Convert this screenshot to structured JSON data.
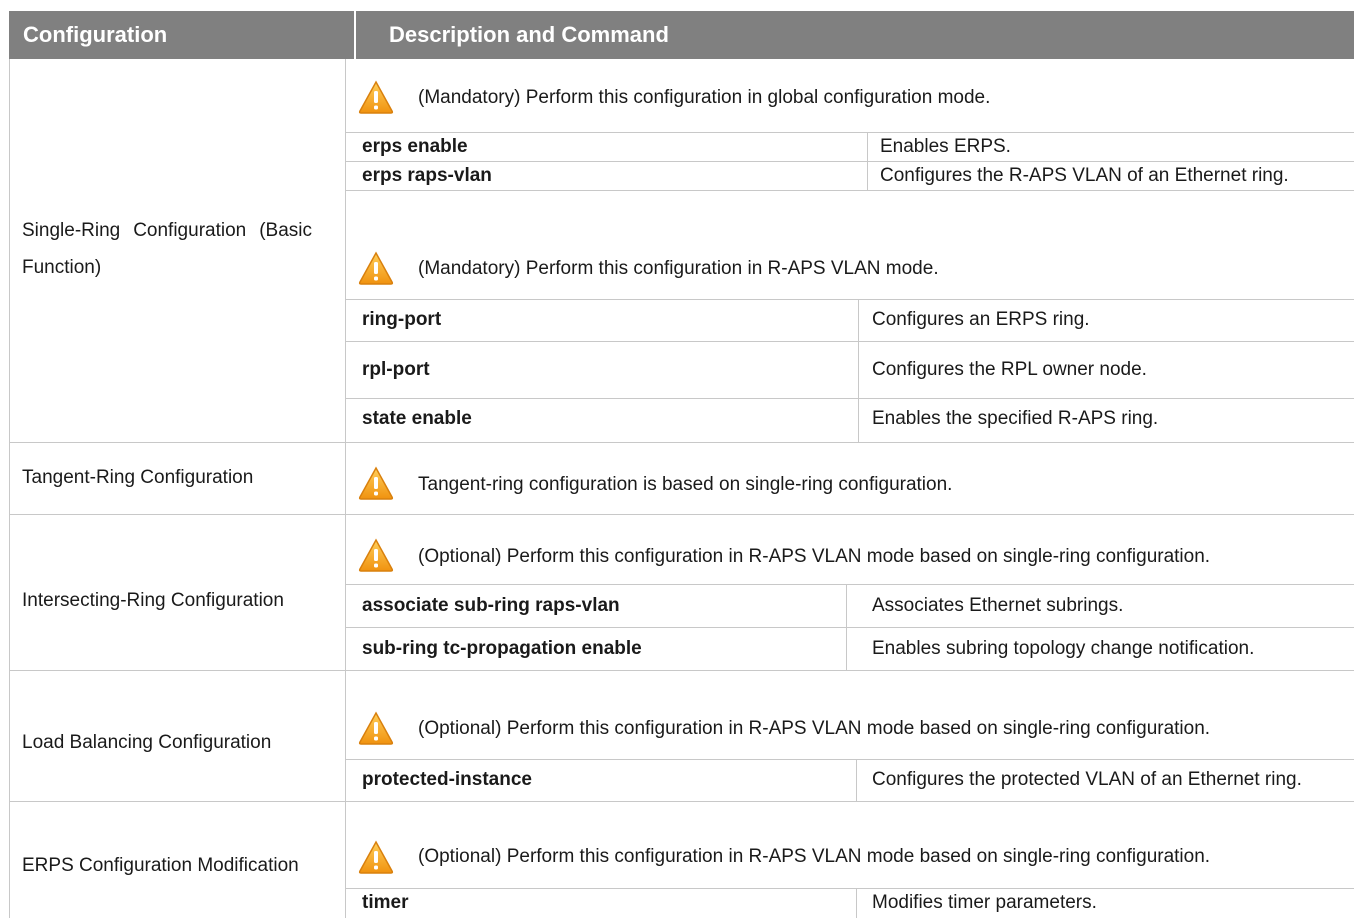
{
  "table": {
    "header": {
      "col1": "Configuration",
      "col2": "Description and Command"
    },
    "sections": [
      {
        "config": "Single-Ring Configuration (Basic Function)",
        "note1": "(Mandatory) Perform this configuration in global configuration mode.",
        "commands1": [
          {
            "cmd": "erps enable",
            "desc": "Enables ERPS."
          },
          {
            "cmd": "erps raps-vlan",
            "desc": "Configures the R-APS VLAN of an Ethernet ring."
          }
        ],
        "note2": "(Mandatory) Perform this configuration in R-APS VLAN mode.",
        "commands2": [
          {
            "cmd": "ring-port",
            "desc": "Configures an ERPS ring."
          },
          {
            "cmd": "rpl-port",
            "desc": "Configures the RPL owner node."
          },
          {
            "cmd": "state enable",
            "desc": "Enables the specified R-APS ring."
          }
        ]
      },
      {
        "config": "Tangent-Ring Configuration",
        "note": "Tangent-ring configuration is based on single-ring configuration."
      },
      {
        "config": "Intersecting-Ring Configuration",
        "note": "(Optional) Perform this configuration in R-APS VLAN mode based on single-ring configuration.",
        "commands": [
          {
            "cmd": "associate sub-ring raps-vlan",
            "desc": "Associates Ethernet subrings."
          },
          {
            "cmd": "sub-ring tc-propagation enable",
            "desc": "Enables subring topology change notification."
          }
        ]
      },
      {
        "config": "Load Balancing Configuration",
        "note": "(Optional) Perform this configuration in R-APS VLAN mode based on single-ring configuration.",
        "commands": [
          {
            "cmd": "protected-instance",
            "desc": "Configures the protected VLAN of an Ethernet ring."
          }
        ]
      },
      {
        "config": "ERPS Configuration Modification",
        "note": "(Optional) Perform this configuration in R-APS VLAN mode based on single-ring configuration.",
        "commands": [
          {
            "cmd": "timer",
            "desc": "Modifies timer parameters."
          }
        ]
      }
    ]
  },
  "icons": {
    "warning": "warning-icon"
  },
  "colors": {
    "header_bg": "#808080",
    "warning_orange": "#f39c12",
    "grid": "#c8c8c8"
  }
}
